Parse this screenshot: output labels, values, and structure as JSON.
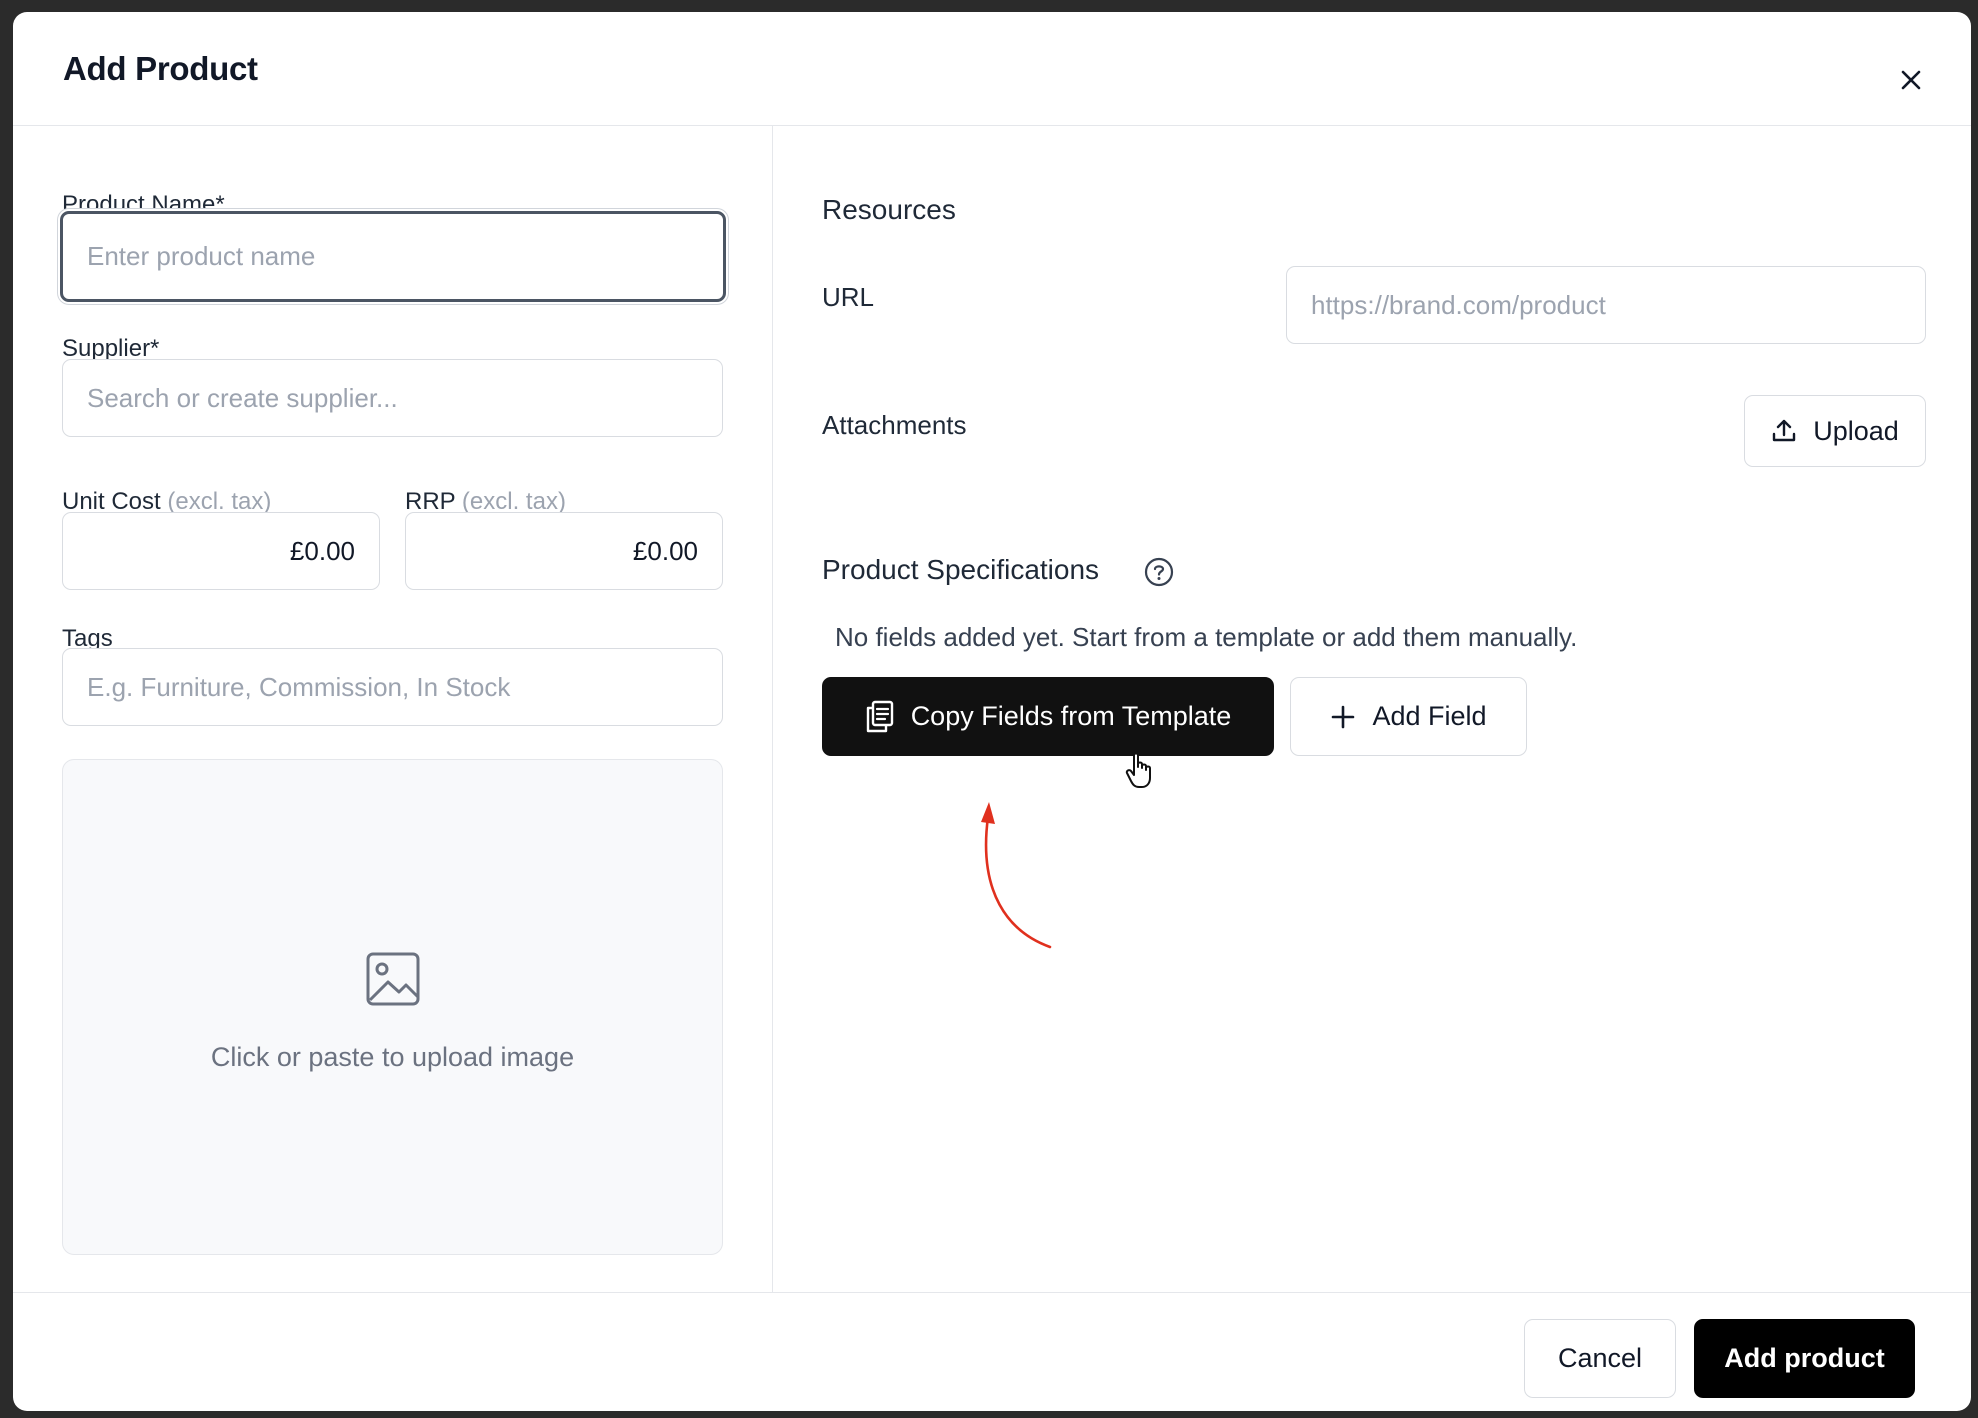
{
  "dialog": {
    "title": "Add Product",
    "close_icon": "close-icon"
  },
  "form": {
    "product_name": {
      "label": "Product Name*",
      "value": "",
      "placeholder": "Enter product name"
    },
    "supplier": {
      "label": "Supplier*",
      "value": "",
      "placeholder": "Search or create supplier..."
    },
    "unit_cost": {
      "label": "Unit Cost",
      "label_note": "(excl. tax)",
      "value": "£0.00"
    },
    "rrp": {
      "label": "RRP",
      "label_note": "(excl. tax)",
      "value": "£0.00"
    },
    "tags": {
      "label": "Tags",
      "value": "",
      "placeholder": "E.g. Furniture, Commission, In Stock"
    },
    "image_upload": {
      "text": "Click or paste to upload image",
      "icon": "image-icon"
    }
  },
  "resources": {
    "title": "Resources",
    "url": {
      "label": "URL",
      "value": "",
      "placeholder": "https://brand.com/product"
    },
    "attachments": {
      "label": "Attachments",
      "upload_label": "Upload",
      "icon": "upload-icon"
    }
  },
  "specifications": {
    "title": "Product Specifications",
    "help_icon": "help-circle-icon",
    "empty_text": "No fields added yet. Start from a template or add them manually.",
    "copy_template_label": "Copy Fields from Template",
    "copy_icon": "copy-icon",
    "add_field_label": "Add Field",
    "add_icon": "plus-icon"
  },
  "footer": {
    "cancel_label": "Cancel",
    "submit_label": "Add product"
  },
  "colors": {
    "primary_button": "#111111",
    "annotation_arrow": "#e0301e",
    "placeholder": "#9ca3af",
    "border": "#d9dce1"
  }
}
